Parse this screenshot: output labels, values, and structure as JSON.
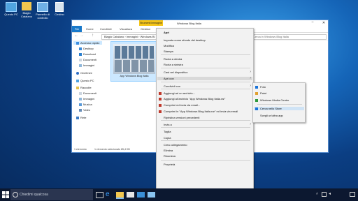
{
  "desktop": {
    "icons": [
      {
        "label": "Questo PC"
      },
      {
        "label": "Biagio Catalano"
      },
      {
        "label": "Pannello di controllo"
      },
      {
        "label": "Cestino"
      }
    ]
  },
  "explorer": {
    "title": "Windows Blog Italia",
    "ribbon_context": "Strumenti immagine",
    "tabs": [
      "File",
      "Home",
      "Condividi",
      "Visualizza",
      "Gestisci"
    ],
    "breadcrumb": "Biagio Catalano › Immagini › Windows Bl",
    "search_placeholder": "Cerca in Windows Blog Italia",
    "thumbnail_caption": "App Windows Blog Italia",
    "nav": {
      "quick_access": "Accesso rapido",
      "items": [
        "Desktop",
        "Download",
        "Documenti",
        "Immagini",
        "OneDrive",
        "Questo PC",
        "Raccolte",
        "Documenti",
        "Immagini",
        "Musica",
        "Video",
        "Rete"
      ]
    },
    "status": {
      "count": "1 elemento",
      "selected": "1 elemento selezionato 85,4 KB"
    }
  },
  "context_menu": {
    "items": [
      {
        "label": "Apri",
        "bold": true
      },
      {
        "label": "Imposta come sfondo del desktop"
      },
      {
        "label": "Modifica"
      },
      {
        "label": "Stampa"
      },
      {
        "label": "Ruota a destra"
      },
      {
        "label": "Ruota a sinistra"
      },
      {
        "label": "Cast nel dispositivo",
        "submenu": true
      },
      {
        "label": "Apri con",
        "submenu": true
      },
      {
        "label": "Condividi con",
        "submenu": true
      },
      {
        "label": "Aggiungi ad un archivio..."
      },
      {
        "label": "Aggiungi all'archivio \"App Windows Blog Italia.rar\""
      },
      {
        "label": "Comprimi ed invia via email..."
      },
      {
        "label": "Comprimi in \"App Windows Blog Italia.rar\" ed invia via email"
      },
      {
        "label": "Ripristina versioni precedenti"
      },
      {
        "label": "Invia a",
        "submenu": true
      },
      {
        "label": "Taglia"
      },
      {
        "label": "Copia"
      },
      {
        "label": "Crea collegamento"
      },
      {
        "label": "Elimina"
      },
      {
        "label": "Rinomina"
      },
      {
        "label": "Proprietà"
      }
    ]
  },
  "open_with_menu": {
    "items": [
      {
        "label": "Foto",
        "icon": "photos-icon"
      },
      {
        "label": "Paint",
        "icon": "paint-icon"
      },
      {
        "label": "Windows Media Center",
        "icon": "media-center-icon"
      },
      {
        "label": "Cerca nello Store",
        "icon": "store-icon"
      },
      {
        "label": "Scegli un'altra app"
      }
    ]
  },
  "taskbar": {
    "search_placeholder": "Chiedimi qualcosa"
  },
  "colors": {
    "accent": "#0078d7",
    "ribbon_context": "#f5c518",
    "taskbar": "#0c1830",
    "menu_bg": "#f2f2f2",
    "highlight": "#cce4f7"
  }
}
